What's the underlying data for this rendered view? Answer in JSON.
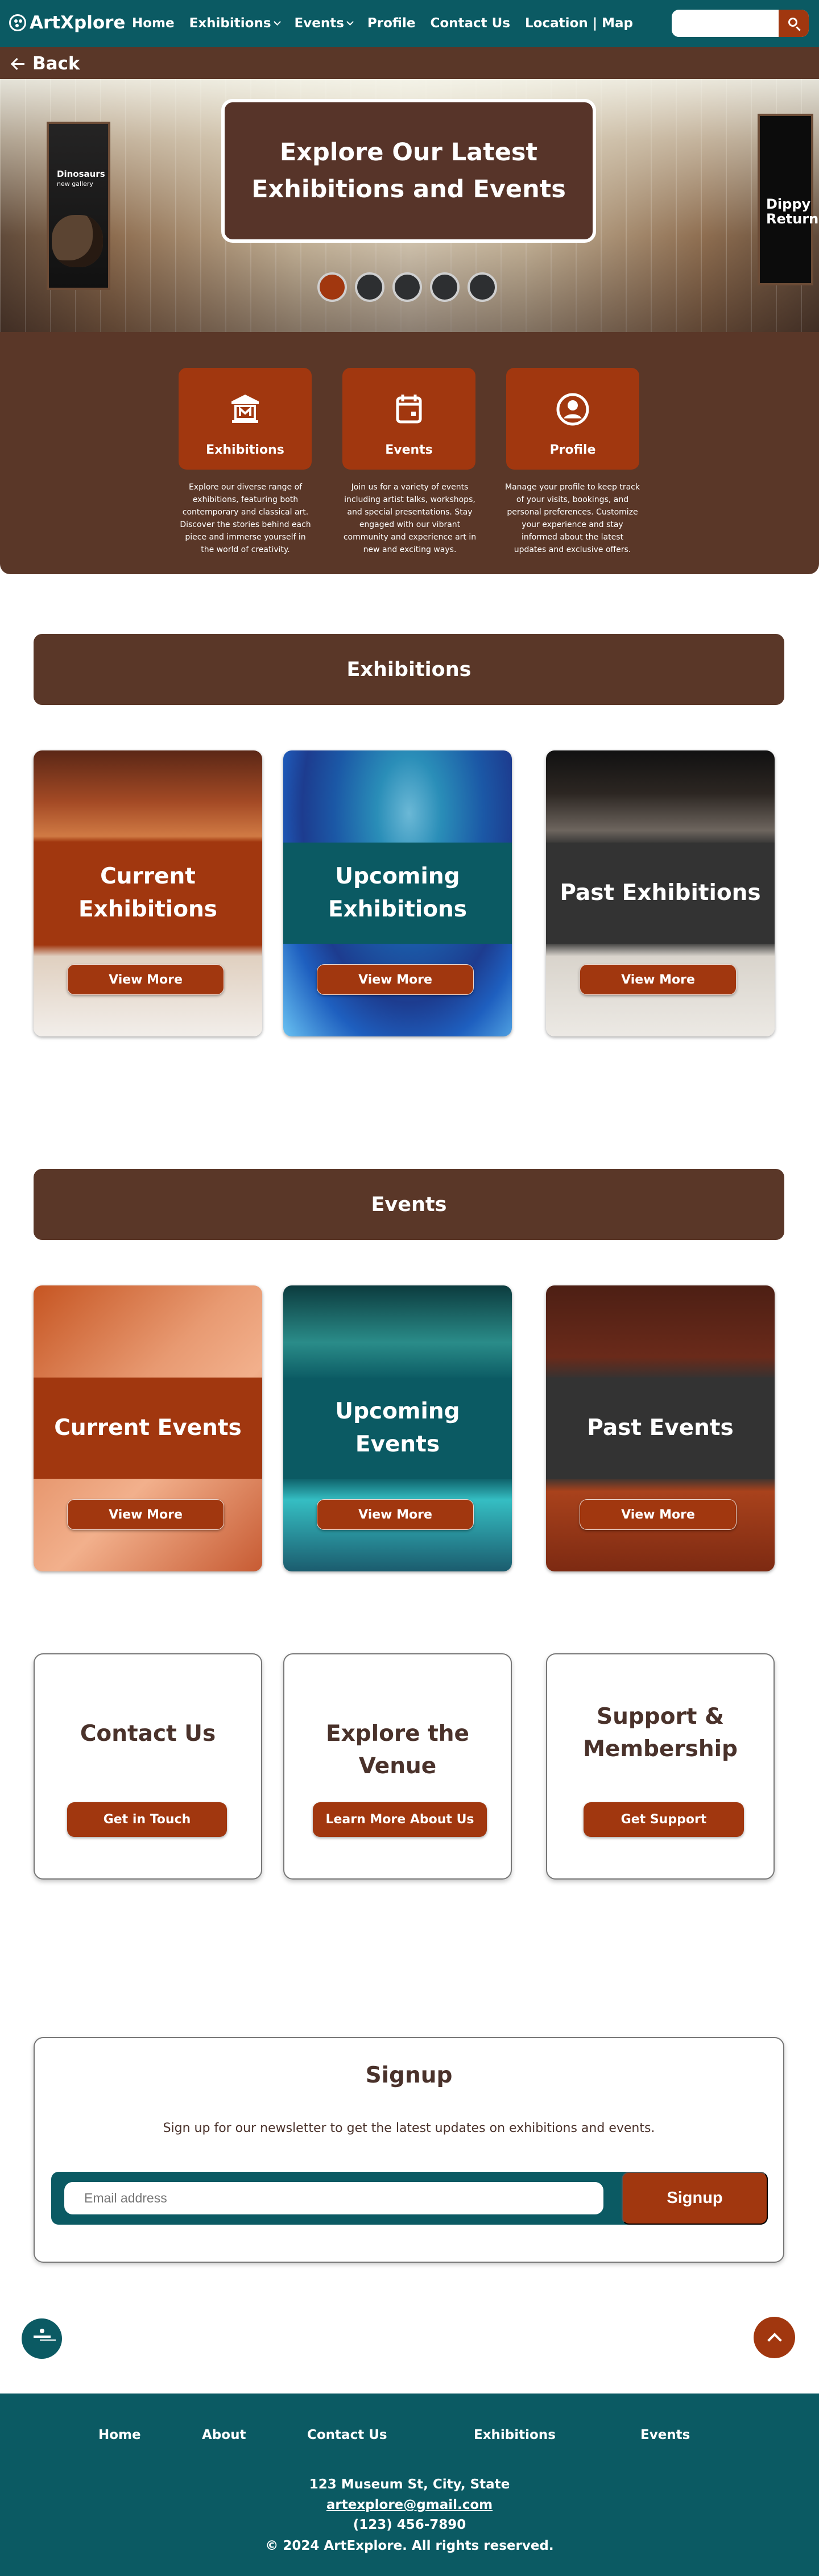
{
  "nav": {
    "brand": "ArtXplore",
    "links": [
      "Home",
      "Exhibitions",
      "Events",
      "Profile",
      "Contact Us",
      "Location | Map"
    ],
    "search_placeholder": "",
    "back_label": "Back"
  },
  "hero": {
    "title": "Explore Our Latest Exhibitions and Events",
    "banner_left_title": "Dinosaurs",
    "banner_left_sub": "new gallery",
    "banner_right_title": "Dippy Returns",
    "slides_count": 5,
    "active_slide": 1
  },
  "quick_links": [
    {
      "icon": "museum-icon",
      "label": "Exhibitions",
      "description": "Explore our diverse range of exhibitions, featuring both contemporary and classical art. Discover the stories behind each piece and immerse yourself in the world of creativity."
    },
    {
      "icon": "calendar-icon",
      "label": "Events",
      "description": "Join us for a variety of events including artist talks, workshops, and special presentations. Stay engaged with our vibrant community and experience art in new and exciting ways."
    },
    {
      "icon": "profile-icon",
      "label": "Profile",
      "description": "Manage your profile to keep track of your visits, bookings, and personal preferences. Customize your experience and stay informed about the latest updates and exclusive offers."
    }
  ],
  "exhibitions": {
    "title": "Exhibitions",
    "cards": [
      {
        "title": "Current Exhibitions",
        "button": "View More"
      },
      {
        "title": "Upcoming Exhibitions",
        "button": "View More"
      },
      {
        "title": "Past Exhibitions",
        "button": "View More"
      }
    ]
  },
  "events": {
    "title": "Events",
    "cards": [
      {
        "title": "Current Events",
        "button": "View More"
      },
      {
        "title": "Upcoming Events",
        "button": "View More"
      },
      {
        "title": "Past Events",
        "button": "View More"
      }
    ]
  },
  "info_cards": [
    {
      "title": "Contact Us",
      "button": "Get in Touch"
    },
    {
      "title": "Explore the Venue",
      "button": "Learn More About Us"
    },
    {
      "title": "Support & Membership",
      "button": "Get Support"
    }
  ],
  "signup": {
    "title": "Signup",
    "description": "Sign up for our newsletter to get the latest updates on exhibitions and events.",
    "placeholder": "Email address",
    "button": "Signup"
  },
  "footer": {
    "links": [
      "Home",
      "About",
      "Contact Us",
      "Exhibitions",
      "Events"
    ],
    "address": "123 Museum St, City, State",
    "email": "artexplore@gmail.com",
    "phone": "(123) 456-7890",
    "copyright": "© 2024 ArtExplore. All rights reserved."
  },
  "colors": {
    "primary_teal": "#0b5a63",
    "brown": "#5a3728",
    "accent_rust": "#a1370f",
    "dark_card": "#333333"
  }
}
